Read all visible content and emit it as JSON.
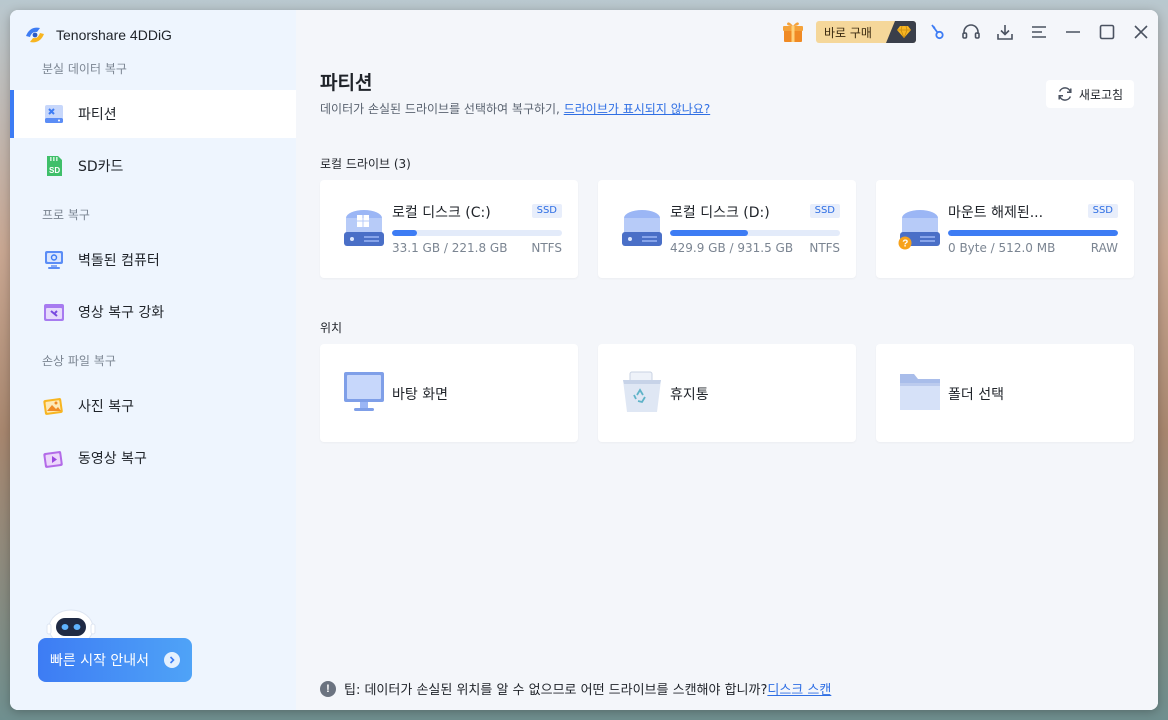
{
  "app": {
    "title": "Tenorshare 4DDiG"
  },
  "sidebar": {
    "sections": [
      {
        "label": "분실 데이터 복구"
      },
      {
        "label": "프로 복구"
      },
      {
        "label": "손상 파일 복구"
      }
    ],
    "items": [
      {
        "label": "파티션",
        "icon": "partition-icon",
        "active": true
      },
      {
        "label": "SD카드",
        "icon": "sd-card-icon"
      },
      {
        "label": "벽돌된 컴퓨터",
        "icon": "bricked-computer-icon"
      },
      {
        "label": "영상 복구 강화",
        "icon": "video-repair-icon"
      },
      {
        "label": "사진 복구",
        "icon": "photo-icon"
      },
      {
        "label": "동영상 복구",
        "icon": "video-icon"
      }
    ],
    "quick_start": "빠른 시작 안내서"
  },
  "toolbar": {
    "buy_label": "바로 구매"
  },
  "main": {
    "title": "파티션",
    "subtitle": "데이터가 손실된 드라이브를 선택하여 복구하기,",
    "subtitle_link": "드라이브가 표시되지 않나요?",
    "refresh": "새로고침",
    "local_drives_label": "로컬 드라이브 (3)",
    "drives": [
      {
        "name": "로컬 디스크 (C:)",
        "badge": "SSD",
        "size": "33.1 GB / 221.8 GB",
        "fs": "NTFS",
        "used_fraction": 0.149
      },
      {
        "name": "로컬 디스크 (D:)",
        "badge": "SSD",
        "size": "429.9 GB / 931.5 GB",
        "fs": "NTFS",
        "used_fraction": 0.461
      },
      {
        "name": "마운트 해제된...",
        "badge": "SSD",
        "size": "0 Byte / 512.0 MB",
        "fs": "RAW",
        "used_fraction": 1.0
      }
    ],
    "locations_label": "위치",
    "locations": [
      {
        "label": "바탕 화면",
        "icon": "desktop-icon"
      },
      {
        "label": "휴지통",
        "icon": "recycle-bin-icon"
      },
      {
        "label": "폴더 선택",
        "icon": "folder-icon"
      }
    ],
    "tip": "팁: 데이터가 손실된 위치를 알 수 없으므로 어떤 드라이브를 스캔해야 합니까?",
    "tip_link": "디스크 스캔"
  },
  "colors": {
    "accent": "#3d7cf4",
    "sidebar_bg": "#eef5fe",
    "main_bg": "#f4f6fa"
  }
}
